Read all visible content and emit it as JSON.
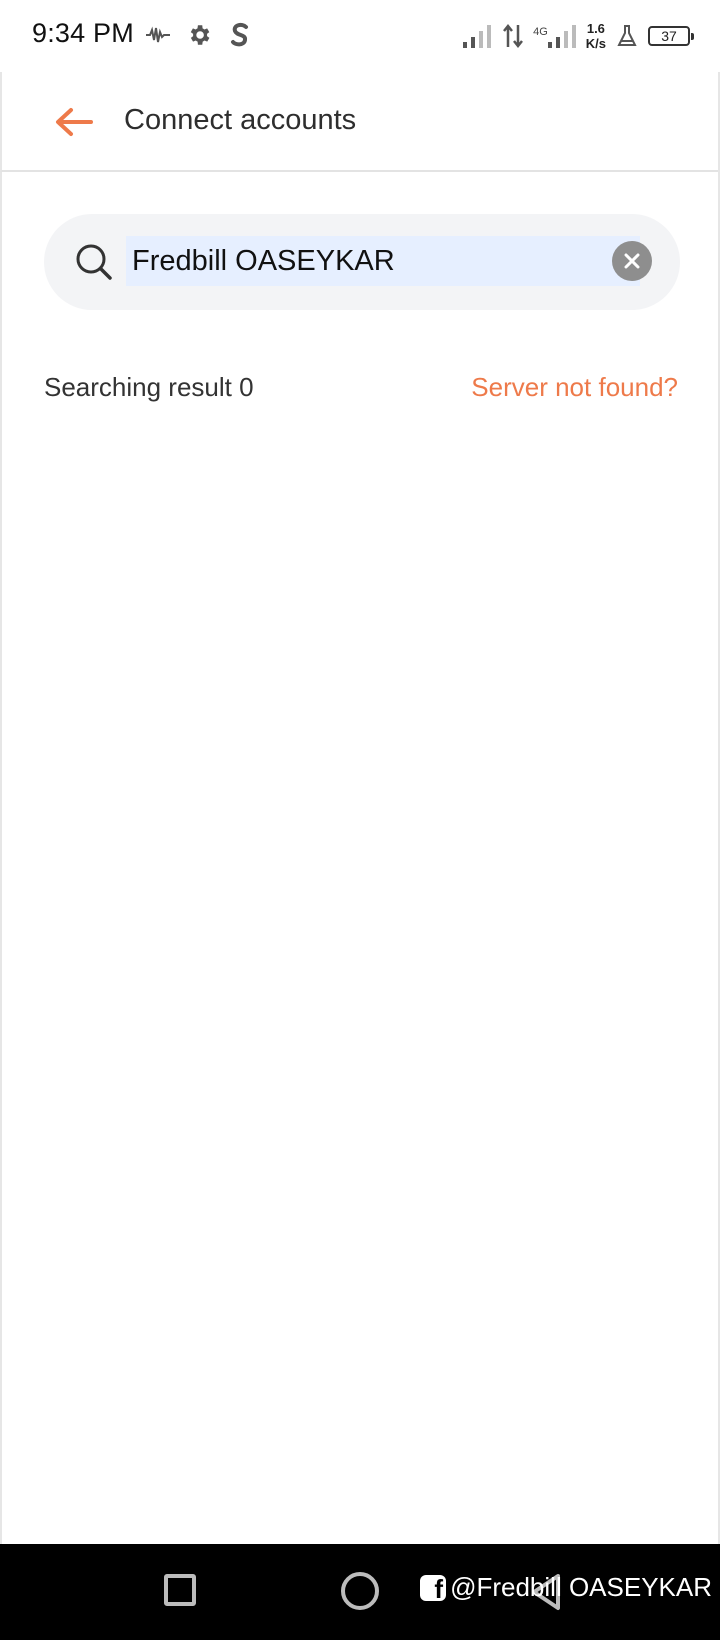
{
  "status_bar": {
    "time": "9:34 PM",
    "network_generation": "4G",
    "net_speed_value": "1.6",
    "net_speed_unit": "K/s",
    "battery_level": "37",
    "icons": [
      "waveform-icon",
      "gear-icon",
      "s-app-icon",
      "signal-icon",
      "data-arrows-icon",
      "signal-4g-icon",
      "flask-icon",
      "battery-icon"
    ]
  },
  "app_bar": {
    "title": "Connect accounts"
  },
  "search": {
    "value": "Fredbill OASEYKAR",
    "clear_icon": "close-circle-icon",
    "search_icon": "search-icon"
  },
  "results": {
    "count_label": "Searching result 0",
    "server_link": "Server not found?"
  },
  "nav_bar": {
    "watermark": "@Fredbill OASEYKAR"
  },
  "colors": {
    "accent": "#ee7a4a",
    "search_bg": "#f3f4f6",
    "selection_bg": "#e6efff",
    "nav_bg": "#000000"
  }
}
